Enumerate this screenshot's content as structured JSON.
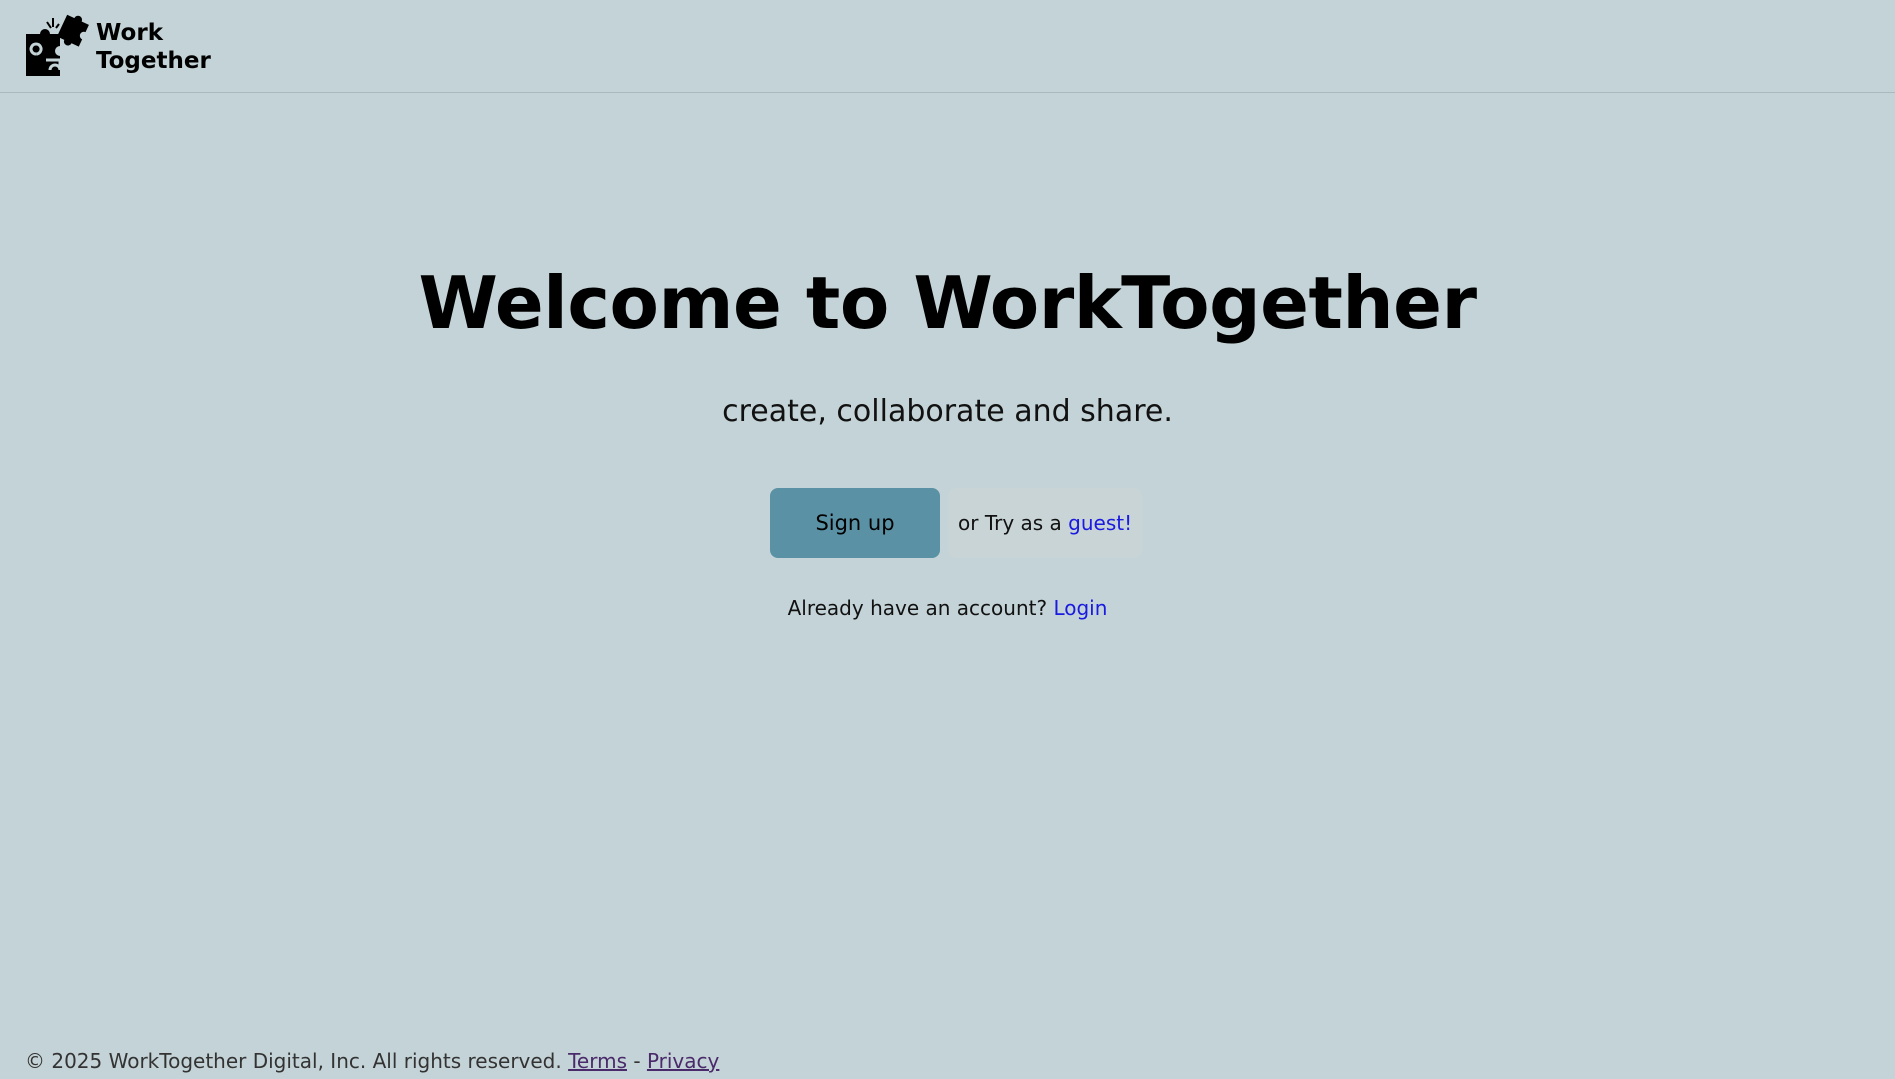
{
  "header": {
    "logo_icon": "puzzle-pieces-icon",
    "logo_line1": "Work",
    "logo_line2": "Together"
  },
  "hero": {
    "title": "Welcome to WorkTogether",
    "subtitle": "create, collaborate and share.",
    "signup_label": "Sign up",
    "guest_prefix": "or Try as a",
    "guest_link": "guest!",
    "login_prefix": "Already have an account?",
    "login_link": "Login"
  },
  "footer": {
    "copyright": "© 2025 WorkTogether Digital, Inc. All rights reserved.",
    "terms_link": "Terms",
    "separator": "-",
    "privacy_link": "Privacy"
  },
  "colors": {
    "background": "#c4d3d7",
    "signup_button": "#5a91a4",
    "link": "#1a1ae0"
  }
}
